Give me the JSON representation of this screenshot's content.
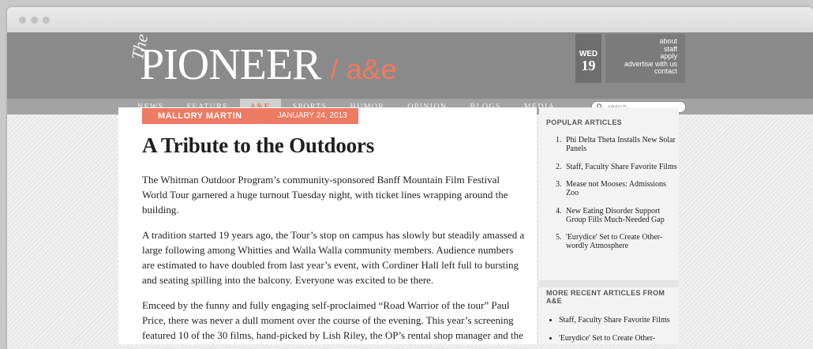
{
  "masthead": {
    "logo_small": "The",
    "logo_main": "PIONEER",
    "section": "/ a&e",
    "day_of_week": "WED",
    "day_number": "19",
    "util_links": [
      "about",
      "staff",
      "apply",
      "advertise with us",
      "contact"
    ]
  },
  "nav": {
    "items": [
      "NEWS",
      "FEATURE",
      "A&E",
      "SPORTS",
      "HUMOR",
      "OPINION",
      "BLOGS",
      "MEDIA"
    ],
    "active": "A&E",
    "search_placeholder": "search"
  },
  "article": {
    "author": "MALLORY MARTIN",
    "date": "JANUARY 24, 2013",
    "title": "A Tribute to the Outdoors",
    "paragraphs": [
      "The Whitman Outdoor Program’s community-sponsored Banff Mountain Film Festival World Tour garnered a huge turnout Tuesday night, with ticket lines wrapping around the building.",
      "A tradition started 19 years ago, the Tour’s stop on campus has slowly but steadily amassed a large following among Whitties and Walla Walla community members. Audience numbers are estimated to have doubled from last year’s event, with Cordiner Hall left full to bursting and seating spilling into the balcony. Everyone was excited to be there.",
      "Emceed by the funny and fully engaging self-proclaimed “Road Warrior of the tour” Paul Price, there was never a dull moment over the course of the evening. This year’s screening featured 10 of the 30 films, hand-picked by Lish Riley, the OP’s rental shop manager and the"
    ]
  },
  "sidebar": {
    "popular_heading": "POPULAR ARTICLES",
    "popular": [
      "Phi Delta Theta Installs New Solar Panels",
      "Staff, Faculty Share Favorite Films",
      "Mease not Mooses: Admissions Zoo",
      "New Eating Disorder Support Group Fills Much-Needed Gap",
      "'Eurydice' Set to Create Other-wordly Atmosphere"
    ],
    "recent_heading": "MORE RECENT ARTICLES FROM A&E",
    "recent": [
      "Staff, Faculty Share Favorite Films",
      "'Eurydice' Set to Create Other-"
    ]
  },
  "colors": {
    "accent": "#ed7a62",
    "masthead": "#8a8a8a",
    "navbar": "#a3a3a3"
  }
}
